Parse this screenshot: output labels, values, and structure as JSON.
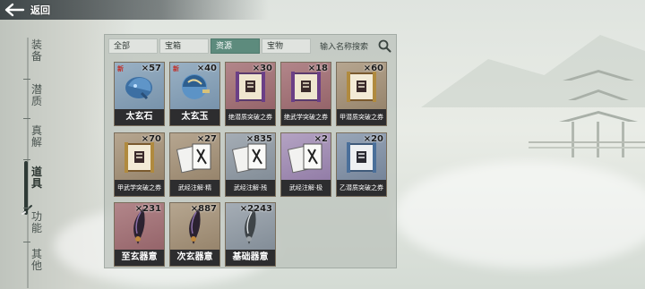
{
  "back_label": "返回",
  "nav": [
    {
      "label": "装备",
      "active": false
    },
    {
      "label": "潜质",
      "active": false
    },
    {
      "label": "真解",
      "active": false
    },
    {
      "label": "道具",
      "active": true
    },
    {
      "label": "功能",
      "active": false
    },
    {
      "label": "其他",
      "active": false
    }
  ],
  "tabs": [
    {
      "label": "全部",
      "active": false
    },
    {
      "label": "宝箱",
      "active": false
    },
    {
      "label": "资源",
      "active": true
    },
    {
      "label": "宝物",
      "active": false
    }
  ],
  "search": {
    "placeholder": "输入名称搜索"
  },
  "items": [
    {
      "name": "太玄石",
      "qty": "×57",
      "new": "新",
      "rarity": "blue",
      "icon": "blue-beast-stone-icon"
    },
    {
      "name": "太玄玉",
      "qty": "×40",
      "new": "新",
      "rarity": "blue",
      "icon": "blue-jade-orb-icon"
    },
    {
      "name": "绝潜质突破之券",
      "qty": "×30",
      "new": "",
      "rarity": "red",
      "icon": "purple-scroll-icon"
    },
    {
      "name": "绝武学突破之券",
      "qty": "×18",
      "new": "",
      "rarity": "red",
      "icon": "purple-scroll-icon"
    },
    {
      "name": "甲潜质突破之券",
      "qty": "×60",
      "new": "",
      "rarity": "brown",
      "icon": "gold-scroll-icon"
    },
    {
      "name": "甲武学突破之券",
      "qty": "×70",
      "new": "",
      "rarity": "brown",
      "icon": "gold-scroll-icon"
    },
    {
      "name": "武经注解·精",
      "qty": "×27",
      "new": "",
      "rarity": "brown",
      "icon": "scripture-cards-icon"
    },
    {
      "name": "武经注解·残",
      "qty": "×835",
      "new": "",
      "rarity": "gray",
      "icon": "scripture-cards-icon"
    },
    {
      "name": "武经注解·极",
      "qty": "×2",
      "new": "",
      "rarity": "purple",
      "icon": "scripture-cards-icon"
    },
    {
      "name": "乙潜质突破之券",
      "qty": "×20",
      "new": "",
      "rarity": "blue2",
      "icon": "blue-scroll-icon"
    },
    {
      "name": "至玄器意",
      "qty": "×231",
      "new": "",
      "rarity": "red",
      "icon": "dark-blade-icon"
    },
    {
      "name": "次玄器意",
      "qty": "×887",
      "new": "",
      "rarity": "brown",
      "icon": "dark-blade-icon"
    },
    {
      "name": "基础器意",
      "qty": "×2243",
      "new": "",
      "rarity": "gray",
      "icon": "silver-blade-icon"
    }
  ]
}
